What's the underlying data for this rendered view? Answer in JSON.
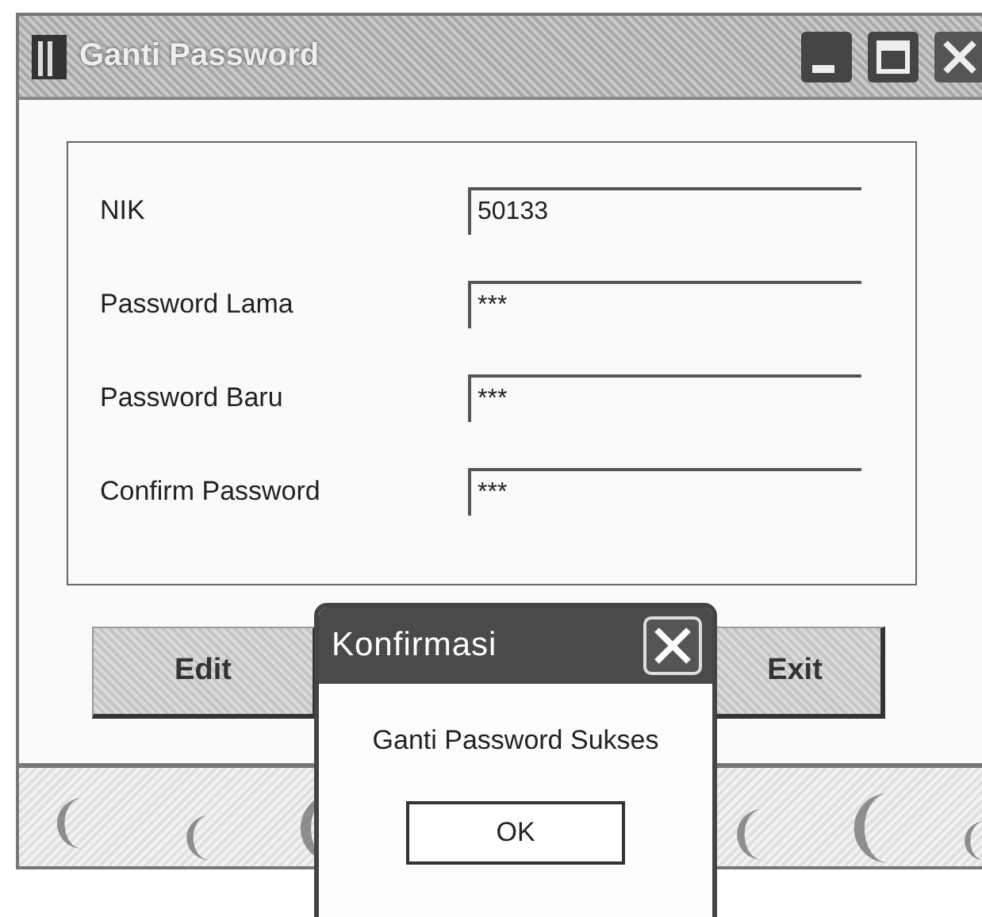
{
  "window": {
    "title": "Ganti Password"
  },
  "form": {
    "fields": [
      {
        "label": "NIK",
        "value": "50133"
      },
      {
        "label": "Password Lama",
        "value": "***"
      },
      {
        "label": "Password Baru",
        "value": "***"
      },
      {
        "label": "Confirm Password",
        "value": "***"
      }
    ]
  },
  "buttons": [
    "Edit",
    "Exit"
  ],
  "dialog": {
    "title": "Konfirmasi",
    "message": "Ganti Password Sukses",
    "button": "OK"
  }
}
